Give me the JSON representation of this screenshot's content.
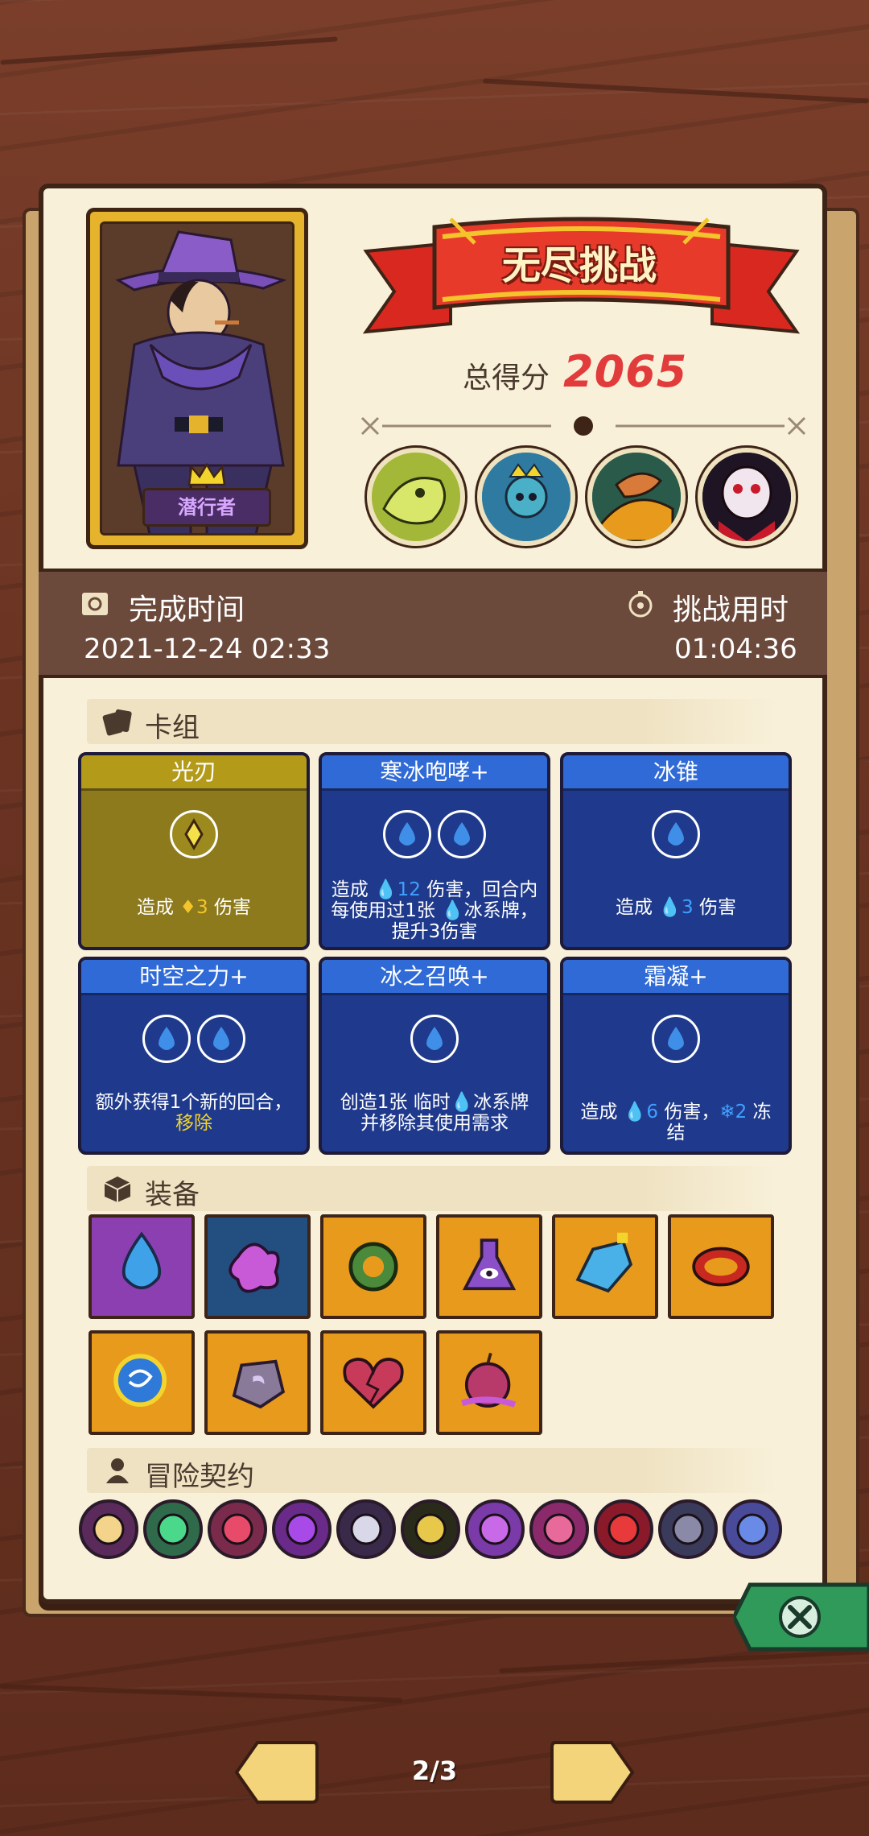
{
  "header": {
    "banner_title": "无尽挑战",
    "score_label": "总得分",
    "score_value": "2065"
  },
  "character": {
    "name": "潜行者"
  },
  "bosses": [
    {
      "icon": "skeletal-dragon-boss-icon"
    },
    {
      "icon": "crowned-squid-boss-icon"
    },
    {
      "icon": "serpent-rider-boss-icon"
    },
    {
      "icon": "vampire-boss-icon"
    }
  ],
  "info": {
    "finish_time_label": "完成时间",
    "finish_time_value": "2021-12-24 02:33",
    "duration_label": "挑战用时",
    "duration_value": "01:04:36"
  },
  "deck": {
    "title": "卡组",
    "cards": [
      {
        "name": "光刃",
        "color": "gold",
        "desc_pre": "造成 ",
        "num": "3",
        "desc_post": " 伤害"
      },
      {
        "name": "寒冰咆哮+",
        "color": "blue",
        "desc_pre": "造成 ",
        "num": "12",
        "desc_post": " 伤害，回合内每使用过1张 冰系牌，提升3伤害"
      },
      {
        "name": "冰锥",
        "color": "blue",
        "desc_pre": "造成 ",
        "num": "3",
        "desc_post": " 伤害"
      },
      {
        "name": "时空之力+",
        "color": "blue",
        "desc_pre": "额外获得1个新的回合，",
        "num": "移除",
        "desc_post": ""
      },
      {
        "name": "冰之召唤+",
        "color": "blue",
        "desc_pre": "创造1张 临时",
        "num": "",
        "desc_post": "冰系牌 并移除其使用需求"
      },
      {
        "name": "霜凝+",
        "color": "blue",
        "desc_pre": "造成 ",
        "num": "6",
        "desc_post": " 伤害，",
        "num2": "2",
        "desc_post2": " 冻结"
      }
    ]
  },
  "equipment": {
    "title": "装备",
    "items": [
      {
        "icon": "water-drop-icon",
        "bg": "#8b3fb0"
      },
      {
        "icon": "purple-splash-icon",
        "bg": "#234f80"
      },
      {
        "icon": "green-ring-icon",
        "bg": "#e89a1c"
      },
      {
        "icon": "eye-flask-icon",
        "bg": "#e89a1c"
      },
      {
        "icon": "blue-crystal-bottle-icon",
        "bg": "#e89a1c"
      },
      {
        "icon": "spiked-bracelet-icon",
        "bg": "#e89a1c"
      },
      {
        "icon": "blue-rune-orb-icon",
        "bg": "#e89a1c"
      },
      {
        "icon": "moon-stone-icon",
        "bg": "#e89a1c"
      },
      {
        "icon": "cracked-heart-icon",
        "bg": "#e89a1c"
      },
      {
        "icon": "poison-apple-icon",
        "bg": "#e89a1c"
      }
    ]
  },
  "contracts": {
    "title": "冒险契约",
    "items": [
      {
        "icon": "bone-icon"
      },
      {
        "icon": "green-shell-icon"
      },
      {
        "icon": "locked-heart-icon"
      },
      {
        "icon": "purple-demon-icon"
      },
      {
        "icon": "skull-claw-icon"
      },
      {
        "icon": "eye-flower-icon"
      },
      {
        "icon": "shield-down-icon"
      },
      {
        "icon": "pink-demon-icon"
      },
      {
        "icon": "red-demon-icon"
      },
      {
        "icon": "stone-block-icon"
      },
      {
        "icon": "blue-flame-icon"
      }
    ]
  },
  "navigation": {
    "page_indicator": "2/3"
  },
  "colors": {
    "panel_bg": "#f8f0d9",
    "info_bar": "#6b4a3c",
    "card_blue": "#1f3a8c",
    "card_gold": "#8c7a1c",
    "score_red": "#e23b3b"
  }
}
